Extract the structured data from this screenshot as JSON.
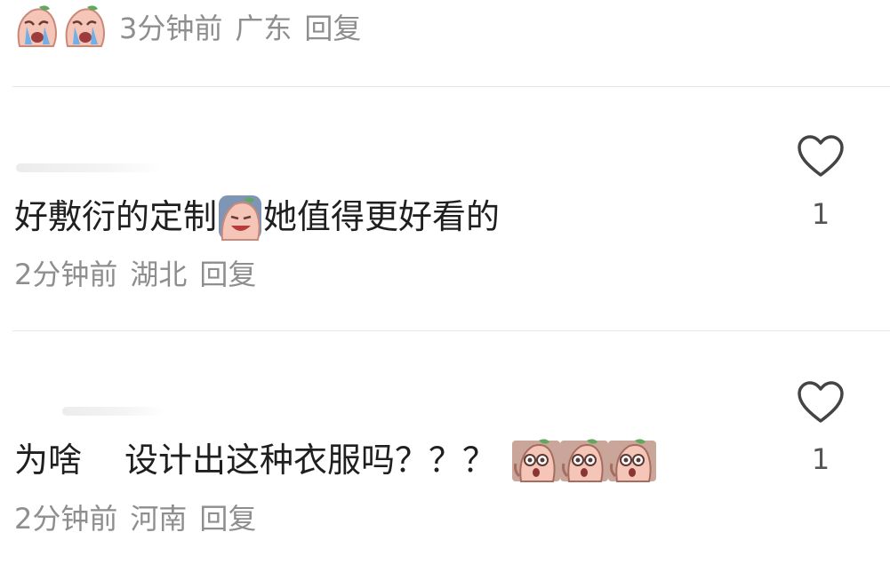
{
  "comment_top": {
    "emoji": [
      "crying-face-emoji",
      "crying-face-emoji"
    ],
    "time": "3分钟前",
    "region": "广东",
    "reply": "回复"
  },
  "comment_1": {
    "text_before": "好敷衍的定制",
    "emoji": "crying-face-emoji",
    "text_after": "她值得更好看的",
    "time": "2分钟前",
    "region": "湖北",
    "reply": "回复",
    "likes": "1"
  },
  "comment_2": {
    "text_a": "为啥",
    "text_b": "设计出这种衣服吗？？？",
    "emoji": [
      "shocked-face-emoji",
      "shocked-face-emoji",
      "shocked-face-emoji"
    ],
    "time": "2分钟前",
    "region": "河南",
    "reply": "回复",
    "likes": "1"
  },
  "icons": {
    "like": "heart-outline-icon"
  },
  "colors": {
    "text": "#1f1f1f",
    "meta": "#8e8e8e",
    "divider": "#e6e6e6",
    "icon_stroke": "#444444"
  }
}
